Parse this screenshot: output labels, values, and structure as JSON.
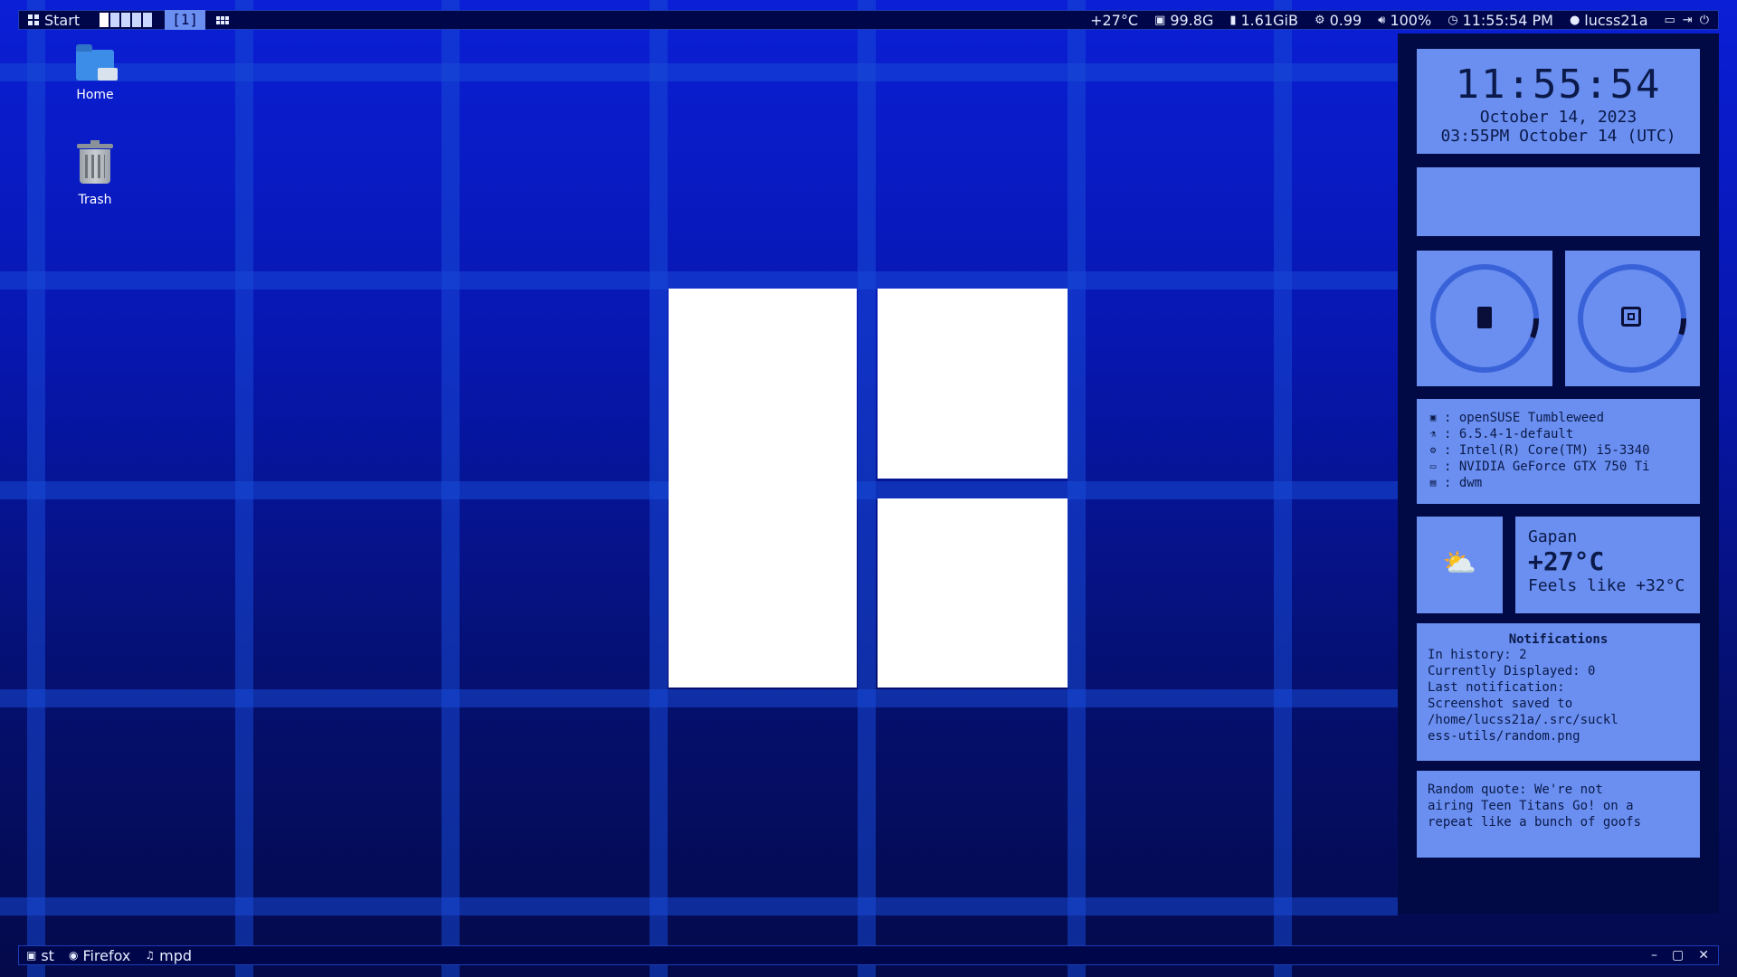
{
  "topbar": {
    "start_label": "Start",
    "layout_label": "[1]",
    "temperature": "+27°C",
    "disk": "99.8G",
    "memory": "1.61GiB",
    "load": "0.99",
    "volume": "100%",
    "time": "11:55:54 PM",
    "user": "lucss21a",
    "tags_count": 5
  },
  "desktop": {
    "icons": [
      {
        "label": "Home"
      },
      {
        "label": "Trash"
      }
    ]
  },
  "panel": {
    "clock": {
      "time": "11:55:54",
      "date": "October 14, 2023",
      "utc": "03:55PM October 14 (UTC)"
    },
    "gauges": {
      "memory_fraction": 0.06,
      "cpu_fraction": 0.05
    },
    "sysinfo": [
      {
        "icon": "os-icon",
        "glyph": "▣",
        "text": ": openSUSE Tumbleweed"
      },
      {
        "icon": "kernel-icon",
        "glyph": "⚗",
        "text": ": 6.5.4-1-default"
      },
      {
        "icon": "cpu-icon",
        "glyph": "⚙",
        "text": ": Intel(R) Core(TM) i5-3340"
      },
      {
        "icon": "gpu-icon",
        "glyph": "▭",
        "text": ": NVIDIA GeForce GTX 750 Ti"
      },
      {
        "icon": "wm-icon",
        "glyph": "▤",
        "text": ": dwm"
      }
    ],
    "weather": {
      "icon": "⛅",
      "city": "Gapan",
      "temp": "+27°C",
      "feels": "Feels like +32°C"
    },
    "notifications": {
      "title": "Notifications",
      "lines": [
        "In history: 2",
        "Currently Displayed: 0",
        "Last notification:",
        "Screenshot saved to",
        "/home/lucss21a/.src/suckl",
        "ess-utils/random.png"
      ]
    },
    "quote": {
      "lines": [
        "Random quote: We're not",
        "airing Teen Titans Go! on a",
        "repeat like a bunch of goofs"
      ]
    }
  },
  "taskbar": {
    "tasks": [
      {
        "label": "st",
        "icon": "terminal-icon",
        "glyph": "▣"
      },
      {
        "label": "Firefox",
        "icon": "firefox-icon",
        "glyph": "◉"
      },
      {
        "label": "mpd",
        "icon": "music-icon",
        "glyph": "♫"
      }
    ],
    "controls": {
      "minimize": "–",
      "maximize": "▢",
      "close": "✕"
    }
  }
}
